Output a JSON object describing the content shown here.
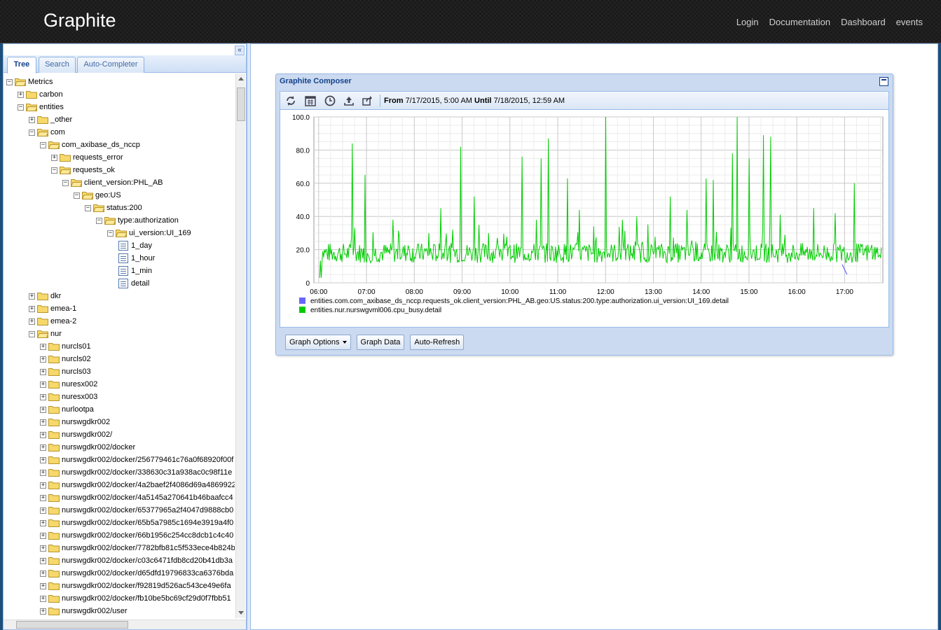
{
  "header": {
    "brand": "Graphite",
    "nav": [
      "Login",
      "Documentation",
      "Dashboard",
      "events"
    ]
  },
  "sidebar": {
    "tabs": [
      "Tree",
      "Search",
      "Auto-Completer"
    ],
    "active_tab": "Tree",
    "tree": [
      {
        "label": "Metrics",
        "depth": 0,
        "type": "folder",
        "expanded": true
      },
      {
        "label": "carbon",
        "depth": 1,
        "type": "folder",
        "expanded": false
      },
      {
        "label": "entities",
        "depth": 1,
        "type": "folder",
        "expanded": true
      },
      {
        "label": "_other",
        "depth": 2,
        "type": "folder",
        "expanded": false
      },
      {
        "label": "com",
        "depth": 2,
        "type": "folder",
        "expanded": true
      },
      {
        "label": "com_axibase_ds_nccp",
        "depth": 3,
        "type": "folder",
        "expanded": true
      },
      {
        "label": "requests_error",
        "depth": 4,
        "type": "folder",
        "expanded": false
      },
      {
        "label": "requests_ok",
        "depth": 4,
        "type": "folder",
        "expanded": true
      },
      {
        "label": "client_version:PHL_AB",
        "depth": 5,
        "type": "folder",
        "expanded": true
      },
      {
        "label": "geo:US",
        "depth": 6,
        "type": "folder",
        "expanded": true
      },
      {
        "label": "status:200",
        "depth": 7,
        "type": "folder",
        "expanded": true
      },
      {
        "label": "type:authorization",
        "depth": 8,
        "type": "folder",
        "expanded": true
      },
      {
        "label": "ui_version:UI_169",
        "depth": 9,
        "type": "folder",
        "expanded": true
      },
      {
        "label": "1_day",
        "depth": 10,
        "type": "leaf"
      },
      {
        "label": "1_hour",
        "depth": 10,
        "type": "leaf"
      },
      {
        "label": "1_min",
        "depth": 10,
        "type": "leaf"
      },
      {
        "label": "detail",
        "depth": 10,
        "type": "leaf"
      },
      {
        "label": "dkr",
        "depth": 2,
        "type": "folder",
        "expanded": false
      },
      {
        "label": "emea-1",
        "depth": 2,
        "type": "folder",
        "expanded": false
      },
      {
        "label": "emea-2",
        "depth": 2,
        "type": "folder",
        "expanded": false
      },
      {
        "label": "nur",
        "depth": 2,
        "type": "folder",
        "expanded": true
      },
      {
        "label": "nurcls01",
        "depth": 3,
        "type": "folder",
        "expanded": false
      },
      {
        "label": "nurcls02",
        "depth": 3,
        "type": "folder",
        "expanded": false
      },
      {
        "label": "nurcls03",
        "depth": 3,
        "type": "folder",
        "expanded": false
      },
      {
        "label": "nuresx002",
        "depth": 3,
        "type": "folder",
        "expanded": false
      },
      {
        "label": "nuresx003",
        "depth": 3,
        "type": "folder",
        "expanded": false
      },
      {
        "label": "nurlootpa",
        "depth": 3,
        "type": "folder",
        "expanded": false
      },
      {
        "label": "nurswgdkr002",
        "depth": 3,
        "type": "folder",
        "expanded": false
      },
      {
        "label": "nurswgdkr002/",
        "depth": 3,
        "type": "folder",
        "expanded": false
      },
      {
        "label": "nurswgdkr002/docker",
        "depth": 3,
        "type": "folder",
        "expanded": false
      },
      {
        "label": "nurswgdkr002/docker/256779461c76a0f68920f00f",
        "depth": 3,
        "type": "folder",
        "expanded": false
      },
      {
        "label": "nurswgdkr002/docker/338630c31a938ac0c98f11e",
        "depth": 3,
        "type": "folder",
        "expanded": false
      },
      {
        "label": "nurswgdkr002/docker/4a2baef2f4086d69a4869922",
        "depth": 3,
        "type": "folder",
        "expanded": false
      },
      {
        "label": "nurswgdkr002/docker/4a5145a270641b46baafcc4",
        "depth": 3,
        "type": "folder",
        "expanded": false
      },
      {
        "label": "nurswgdkr002/docker/65377965a2f4047d9888cb0",
        "depth": 3,
        "type": "folder",
        "expanded": false
      },
      {
        "label": "nurswgdkr002/docker/65b5a7985c1694e3919a4f0",
        "depth": 3,
        "type": "folder",
        "expanded": false
      },
      {
        "label": "nurswgdkr002/docker/66b1956c254cc8dcb1c4c40",
        "depth": 3,
        "type": "folder",
        "expanded": false
      },
      {
        "label": "nurswgdkr002/docker/7782bfb81c5f533ece4b824b",
        "depth": 3,
        "type": "folder",
        "expanded": false
      },
      {
        "label": "nurswgdkr002/docker/c03c6471fdb8cd20b41db3a",
        "depth": 3,
        "type": "folder",
        "expanded": false
      },
      {
        "label": "nurswgdkr002/docker/d65dfd19796833ca6376bda",
        "depth": 3,
        "type": "folder",
        "expanded": false
      },
      {
        "label": "nurswgdkr002/docker/f92819d526ac543ce49e6fa",
        "depth": 3,
        "type": "folder",
        "expanded": false
      },
      {
        "label": "nurswgdkr002/docker/fb10be5bc69cf29d0f7fbb51",
        "depth": 3,
        "type": "folder",
        "expanded": false
      },
      {
        "label": "nurswgdkr002/user",
        "depth": 3,
        "type": "folder",
        "expanded": false
      }
    ]
  },
  "composer": {
    "title": "Graphite Composer",
    "time_from_label": "From",
    "time_from": "7/17/2015, 5:00 AM",
    "time_until_label": "Until",
    "time_until": "7/18/2015, 12:59 AM",
    "toolbar_icons": [
      "refresh-icon",
      "calendar-icon",
      "clock-icon",
      "upload-icon",
      "share-icon"
    ],
    "buttons": {
      "graph_options": "Graph Options",
      "graph_data": "Graph Data",
      "auto_refresh": "Auto-Refresh"
    }
  },
  "chart_data": {
    "type": "line",
    "x_ticks": [
      "06:00",
      "07:00",
      "08:00",
      "09:00",
      "10:00",
      "11:00",
      "12:00",
      "13:00",
      "14:00",
      "15:00",
      "16:00",
      "17:00"
    ],
    "y_ticks": [
      "0",
      "20.0",
      "40.0",
      "60.0",
      "80.0",
      "100.0"
    ],
    "ylim": [
      0,
      100
    ],
    "x_range_hours": [
      5.9,
      17.8
    ],
    "grid": true,
    "legend_position": "bottom-left",
    "series": [
      {
        "name": "entities.com.com_axibase_ds_nccp.requests_ok.client_version:PHL_AB.geo:US.status:200.type:authorization.ui_version:UI_169.detail",
        "color": "#6666ff",
        "points": [
          [
            16.95,
            11
          ],
          [
            17.05,
            5
          ]
        ]
      },
      {
        "name": "entities.nur.nurswgvml006.cpu_busy.detail",
        "color": "#00cc00",
        "spikes": [
          [
            6.05,
            3
          ],
          [
            6.7,
            84
          ],
          [
            6.97,
            65
          ],
          [
            7.55,
            38
          ],
          [
            8.3,
            30
          ],
          [
            8.55,
            45
          ],
          [
            8.97,
            82
          ],
          [
            9.25,
            52
          ],
          [
            9.35,
            35
          ],
          [
            9.55,
            30
          ],
          [
            10.25,
            76
          ],
          [
            10.55,
            38
          ],
          [
            10.65,
            75
          ],
          [
            10.8,
            87
          ],
          [
            11.2,
            63
          ],
          [
            11.45,
            44
          ],
          [
            11.75,
            34
          ],
          [
            12.0,
            100
          ],
          [
            12.35,
            38
          ],
          [
            12.65,
            40
          ],
          [
            13.35,
            52
          ],
          [
            13.7,
            44
          ],
          [
            14.1,
            63
          ],
          [
            14.25,
            62
          ],
          [
            14.65,
            78
          ],
          [
            14.75,
            100
          ],
          [
            15.0,
            75
          ],
          [
            15.3,
            89
          ],
          [
            15.45,
            88
          ],
          [
            15.65,
            41
          ],
          [
            16.35,
            45
          ],
          [
            16.8,
            42
          ],
          [
            17.2,
            60
          ],
          [
            17.8,
            14
          ]
        ],
        "baseline_range": [
          12,
          24
        ]
      }
    ]
  }
}
